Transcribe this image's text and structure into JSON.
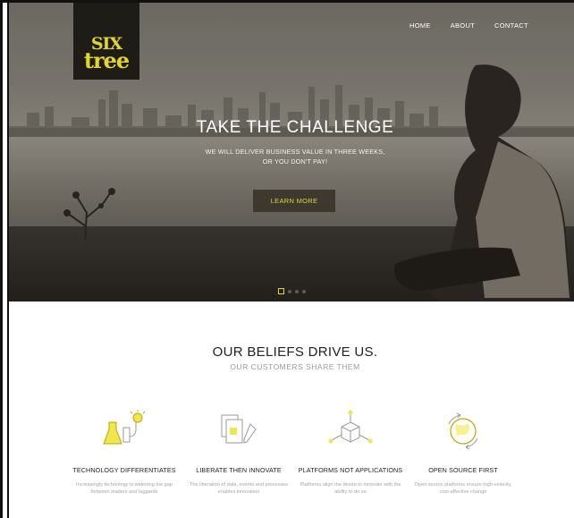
{
  "logo": {
    "line1": "SIX",
    "line2": "tree"
  },
  "nav": {
    "home": "HOME",
    "about": "ABOUT",
    "contact": "CONTACT"
  },
  "hero": {
    "title": "TAKE THE CHALLENGE",
    "subtitle_line1": "WE WILL DELIVER BUSINESS VALUE IN THREE WEEKS,",
    "subtitle_line2": "OR YOU DON'T PAY!",
    "button": "LEARN MORE"
  },
  "beliefs": {
    "title": "OUR BELIEFS DRIVE US.",
    "subtitle": "OUR CUSTOMERS SHARE THEM",
    "items": [
      {
        "title": "TECHNOLOGY DIFFERENTIATES",
        "desc": "Increasingly technology is widening the gap between leaders and laggards",
        "icon": "flask-bulb-icon"
      },
      {
        "title": "LIBERATE THEN INNOVATE",
        "desc": "The liberation of data, events and processes enables innovation",
        "icon": "documents-pen-icon"
      },
      {
        "title": "PLATFORMS NOT APPLICATIONS",
        "desc": "Platforms align the desire to innovate with the ability to do so",
        "icon": "cube-network-icon"
      },
      {
        "title": "OPEN SOURCE FIRST",
        "desc": "Open source platforms ensure high-velocity, cost-effective change",
        "icon": "globe-arrows-icon"
      }
    ]
  },
  "colors": {
    "accent": "#e4d628",
    "logo_bg": "#1d1c17"
  }
}
